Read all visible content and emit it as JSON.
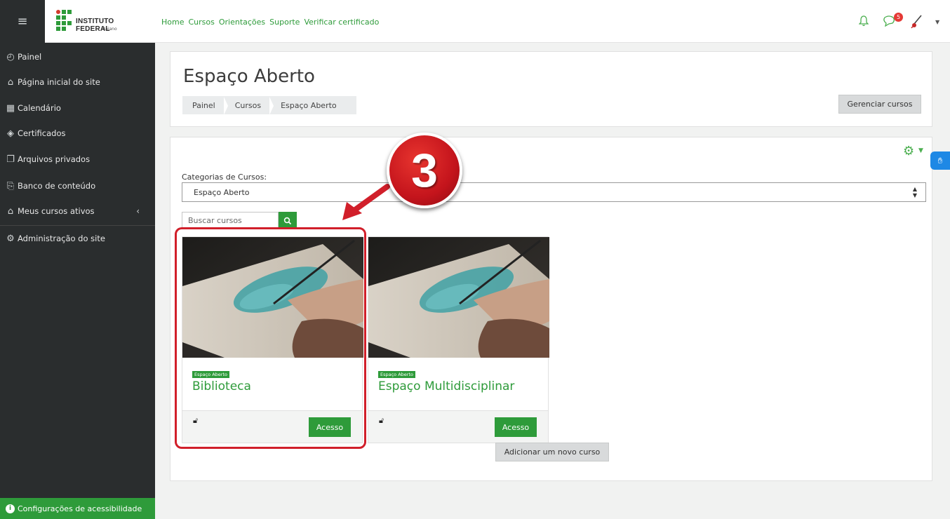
{
  "topbar": {
    "menu_icon": "≡",
    "logo_title": "INSTITUTO FEDERAL",
    "logo_sub": "Baiano",
    "nav": [
      "Home",
      "Cursos",
      "Orientações",
      "Suporte",
      "Verificar certificado"
    ],
    "notifications_badge": "5",
    "icons": [
      "bell-icon",
      "chat-icon",
      "avatar",
      "caret-down-icon"
    ]
  },
  "sidebar": {
    "items": [
      {
        "label": "Painel",
        "icon": "◴"
      },
      {
        "label": "Página inicial do site",
        "icon": "⌂"
      },
      {
        "label": "Calendário",
        "icon": "▦"
      },
      {
        "label": "Certificados",
        "icon": "◈"
      },
      {
        "label": "Arquivos privados",
        "icon": "❐"
      },
      {
        "label": "Banco de conteúdo",
        "icon": "⎘"
      },
      {
        "label": "Meus cursos ativos",
        "icon": "⌂",
        "chevron": "‹"
      },
      {
        "label": "Administração do site",
        "icon": "⚙"
      }
    ],
    "accessibility": "Configurações de acessibilidade"
  },
  "header": {
    "title": "Espaço Aberto",
    "breadcrumb": [
      "Painel",
      "Cursos",
      "Espaço Aberto"
    ],
    "manage_button": "Gerenciar cursos"
  },
  "main": {
    "category_label": "Categorias de Cursos:",
    "category_selected": "Espaço Aberto",
    "search_placeholder": "Buscar cursos",
    "courses": [
      {
        "category": "Espaço Aberto",
        "name": "Biblioteca",
        "button": "Acesso"
      },
      {
        "category": "Espaço Aberto",
        "name": "Espaço Multidisciplinar",
        "button": "Acesso"
      }
    ],
    "add_course_button": "Adicionar um novo curso"
  },
  "annotation": {
    "step_number": "3"
  },
  "colors": {
    "brand_green": "#2e9b3a",
    "sidebar_bg": "#2a2d2e",
    "annotation_red": "#d11f2a"
  }
}
